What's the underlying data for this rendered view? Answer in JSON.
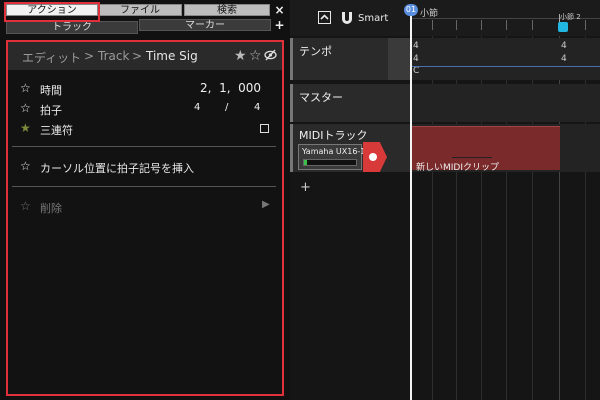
{
  "tabs": {
    "row1": [
      {
        "label": "アクション",
        "active": true
      },
      {
        "label": "ファイル",
        "active": false
      },
      {
        "label": "検索",
        "active": false
      }
    ],
    "row2": [
      {
        "label": "トラック"
      },
      {
        "label": "マーカー"
      }
    ],
    "close_glyph": "×",
    "plus_glyph": "+"
  },
  "panel": {
    "breadcrumb": [
      "エディット",
      ">",
      "Track",
      ">",
      "Time Sig"
    ],
    "header_icons": [
      "star-filled-icon",
      "star-outline-icon",
      "eye-slash-icon"
    ],
    "fields": [
      {
        "label": "時間",
        "value": "2,  1,  000",
        "starred": false
      },
      {
        "label": "拍子",
        "numerator": "4",
        "separator": "/",
        "denominator": "4",
        "starred": false
      },
      {
        "label": "三連符",
        "checked": false,
        "starred": true
      }
    ],
    "actions": [
      {
        "label": "カーソル位置に拍子記号を挿入"
      }
    ],
    "submenu": {
      "label": "削除",
      "arrow": "▶"
    }
  },
  "toolbar": {
    "smart_label": "Smart"
  },
  "ruler": {
    "playhead_label": "01",
    "bar1_label": "小節",
    "bar2_label": "小節 2"
  },
  "tracks": [
    {
      "name": "テンポ",
      "sig_top_1": "4",
      "sig_bottom_1": "4",
      "sig_top_2": "4",
      "sig_bottom_2": "4",
      "chord": "C"
    },
    {
      "name": "マスター"
    },
    {
      "name": "MIDIトラック",
      "instrument": "Yamaha UX16-1",
      "meter_level": 0.05,
      "clip_name": "新しいMIDIクリップ"
    }
  ],
  "add_track_label": "+",
  "colors": {
    "highlight": "#e0303a",
    "record": "#d83a3a",
    "clip": "#7a2a2a",
    "playhead_knob": "#5a8fe0",
    "marker": "#22b7e0"
  }
}
